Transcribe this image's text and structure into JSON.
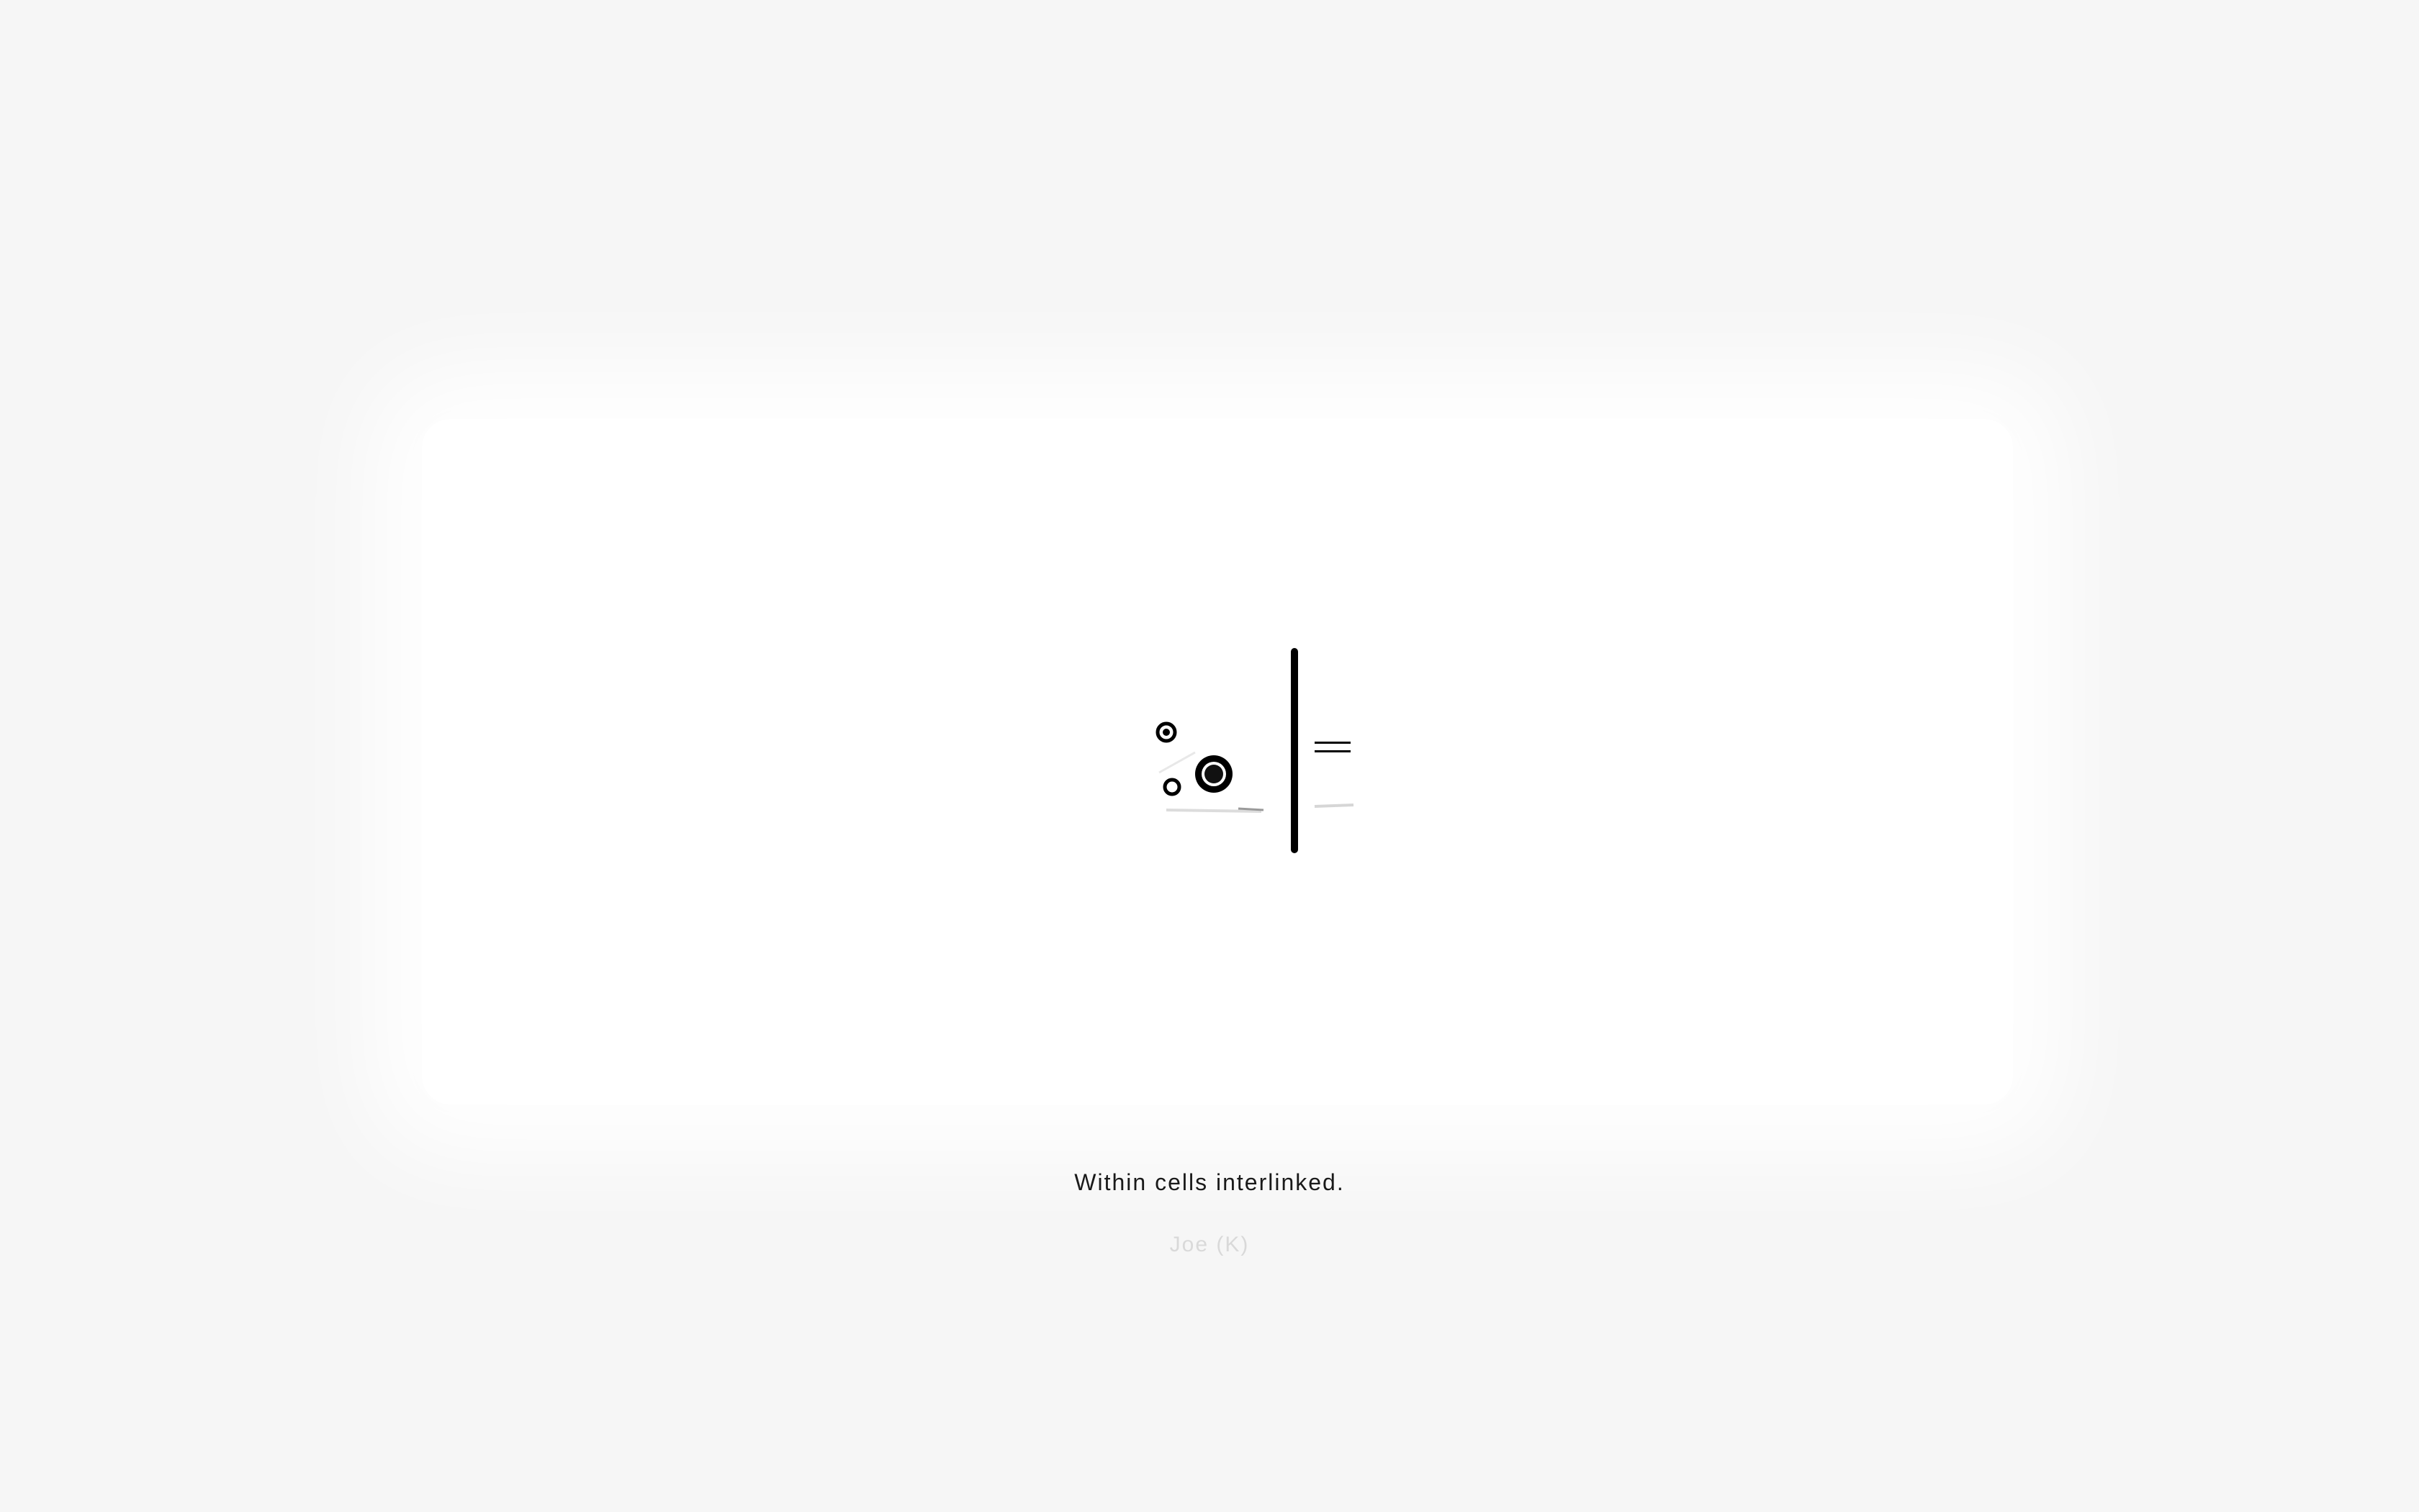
{
  "caption": {
    "text": "Within cells interlinked."
  },
  "attribution": {
    "text": "Joe (K)"
  },
  "artwork": {
    "icon": "abstract-geometric-artwork-icon"
  },
  "colors": {
    "background": "#f6f6f6",
    "card": "#ffffff",
    "ink": "#000000",
    "caption": "#1a1a1a",
    "attribution": "#d9d9d9"
  }
}
